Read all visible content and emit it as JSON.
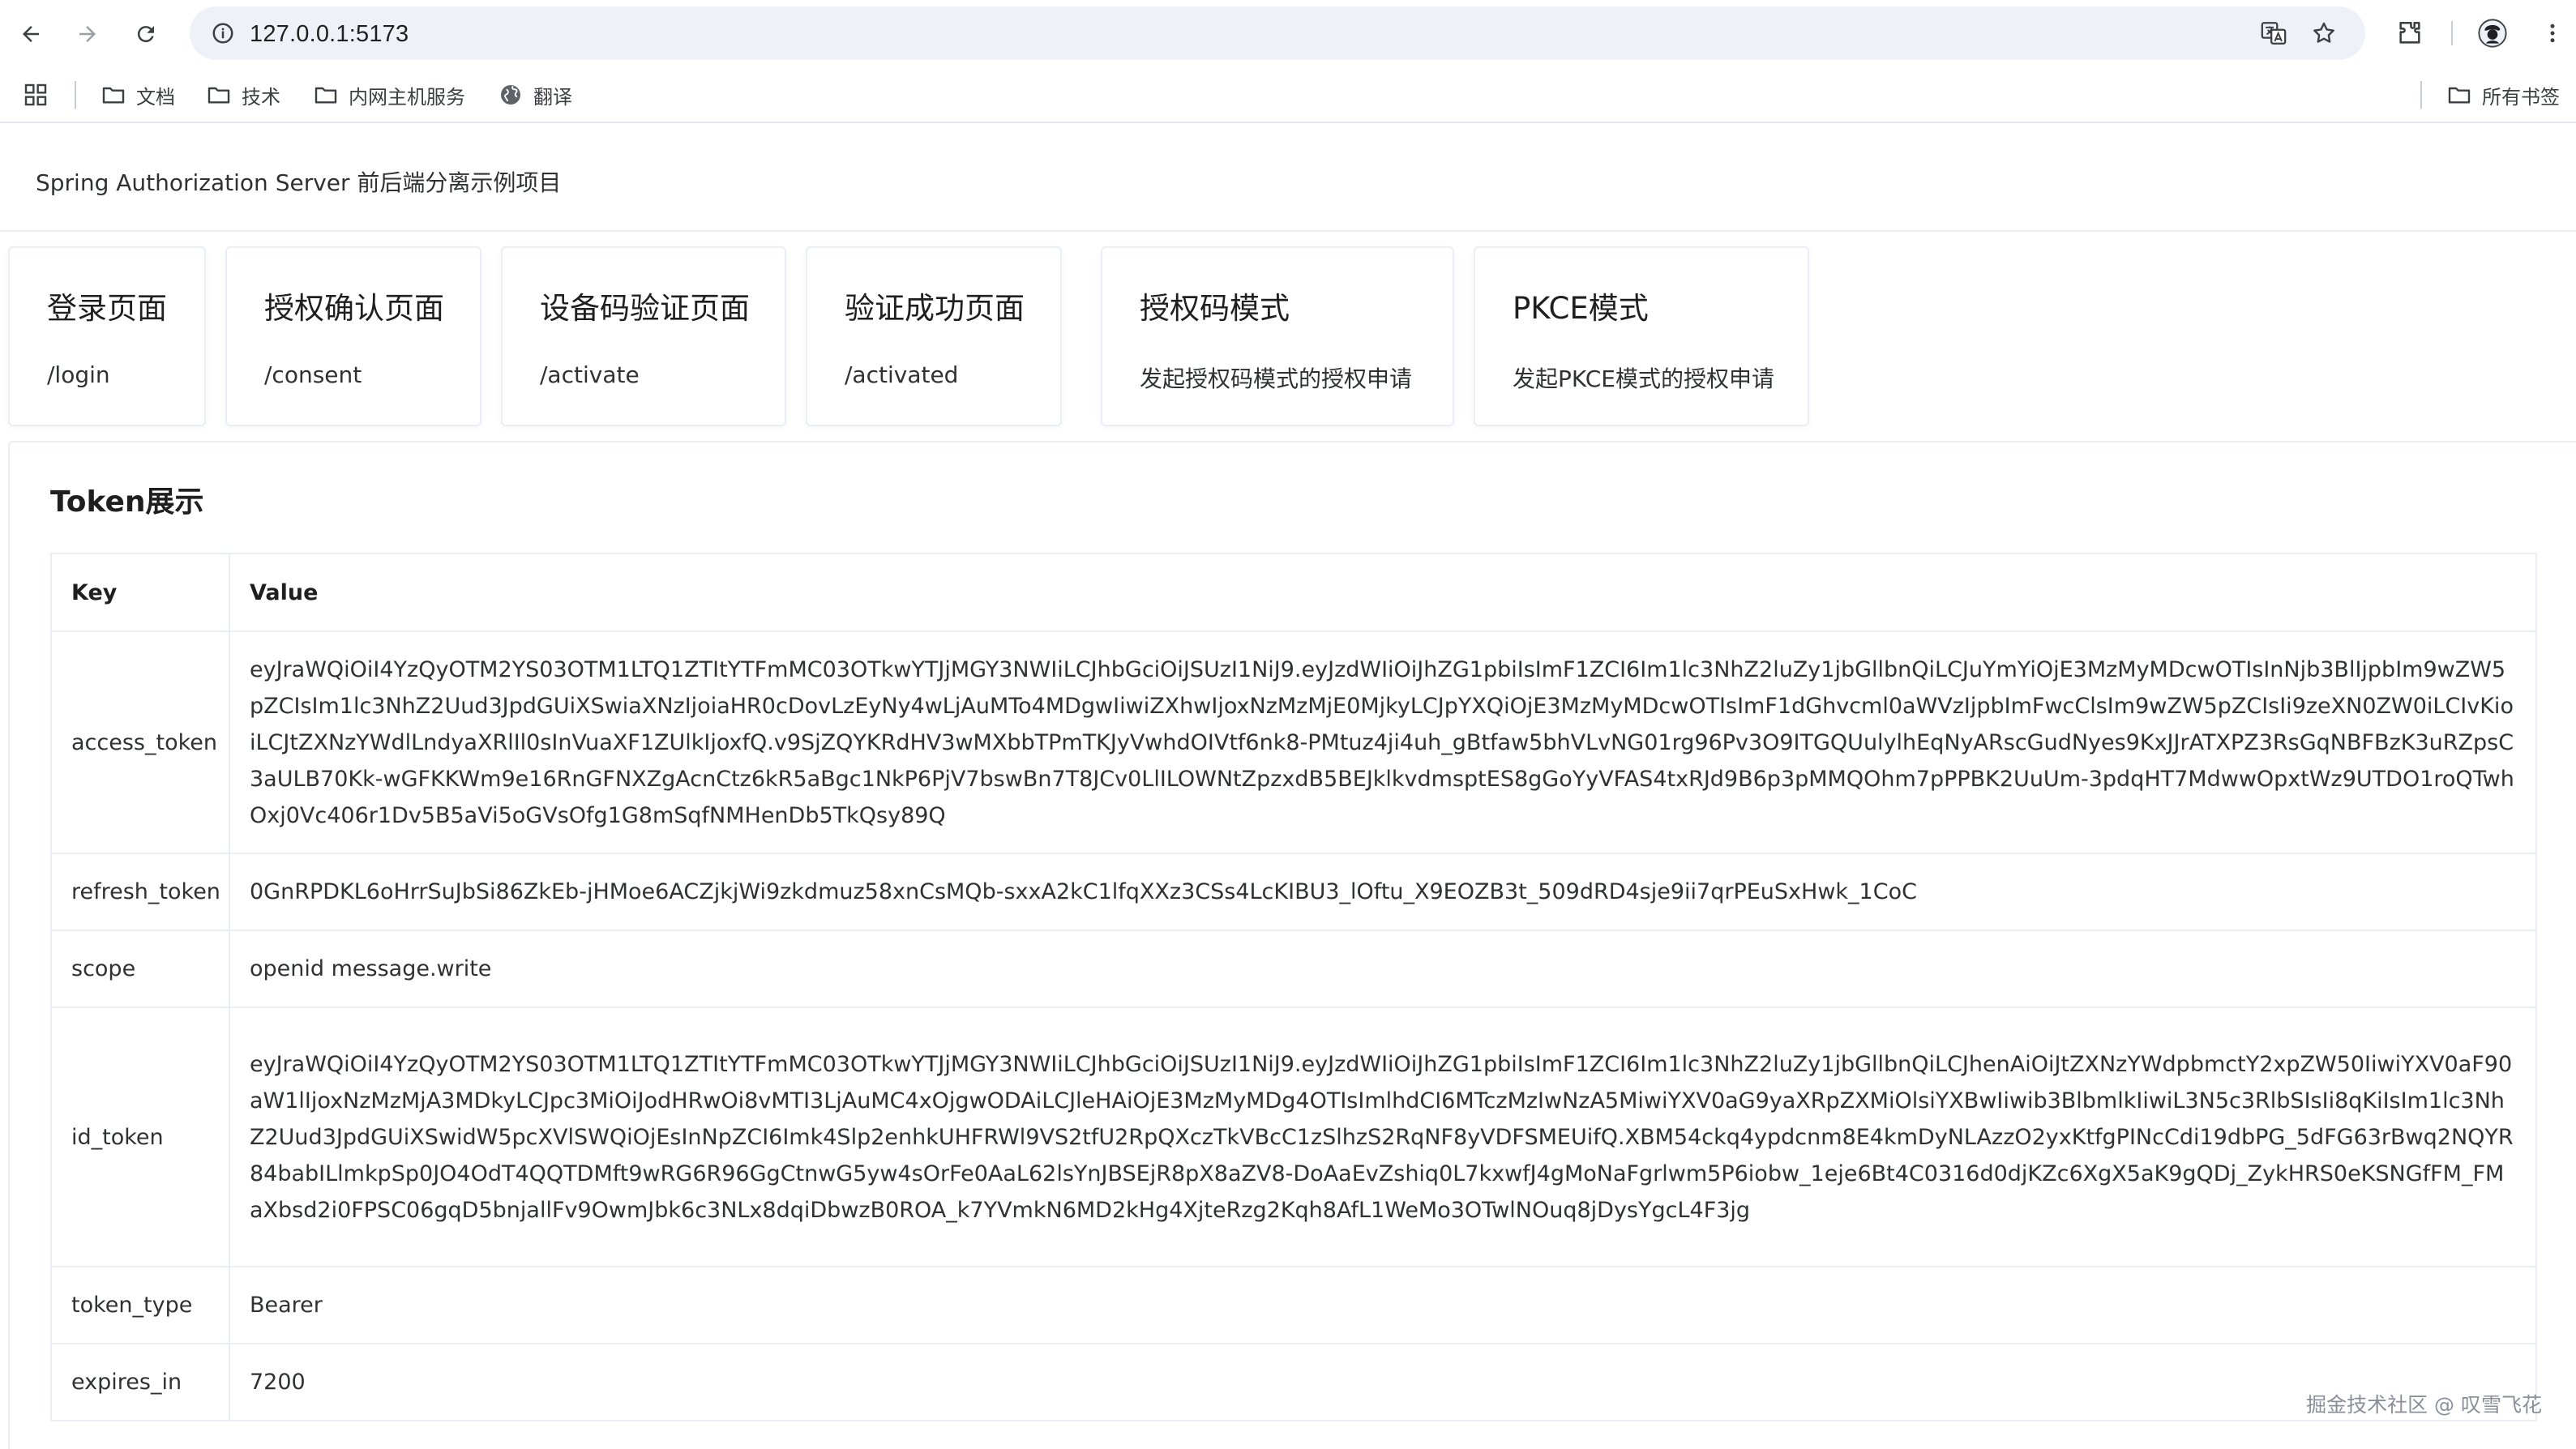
{
  "browser": {
    "url": "127.0.0.1:5173",
    "icons": [
      "back-icon",
      "forward-icon",
      "reload-icon",
      "site-info-icon",
      "translate-icon",
      "star-icon",
      "extensions-icon",
      "profile-icon",
      "menu-icon"
    ]
  },
  "bookmarks": {
    "items": [
      {
        "label": "文档",
        "icon": "folder-icon"
      },
      {
        "label": "技术",
        "icon": "folder-icon"
      },
      {
        "label": "内网主机服务",
        "icon": "folder-icon"
      },
      {
        "label": "翻译",
        "icon": "globe-icon"
      }
    ],
    "all_bookmarks": "所有书签"
  },
  "app": {
    "title": "Spring Authorization Server 前后端分离示例项目"
  },
  "cards": [
    {
      "title": "登录页面",
      "subtitle": "/login"
    },
    {
      "title": "授权确认页面",
      "subtitle": "/consent"
    },
    {
      "title": "设备码验证页面",
      "subtitle": "/activate"
    },
    {
      "title": "验证成功页面",
      "subtitle": "/activated"
    },
    {
      "title": "授权码模式",
      "subtitle": "发起授权码模式的授权申请"
    },
    {
      "title": "PKCE模式",
      "subtitle": "发起PKCE模式的授权申请"
    }
  ],
  "token_panel": {
    "title": "Token展示",
    "headers": {
      "key": "Key",
      "value": "Value"
    },
    "rows": [
      {
        "key": "access_token",
        "value": "eyJraWQiOiI4YzQyOTM2YS03OTM1LTQ1ZTItYTFmMC03OTkwYTJjMGY3NWIiLCJhbGciOiJSUzI1NiJ9.eyJzdWIiOiJhZG1pbiIsImF1ZCI6Im1lc3NhZ2luZy1jbGllbnQiLCJuYmYiOjE3MzMyMDcwOTIsInNjb3BlIjpbIm9wZW5pZCIsIm1lc3NhZ2Uud3JpdGUiXSwiaXNzIjoiaHR0cDovLzEyNy4wLjAuMTo4MDgwIiwiZXhwIjoxNzMzMjE0MjkyLCJpYXQiOjE3MzMyMDcwOTIsImF1dGhvcml0aWVzIjpbImFwcClsIm9wZW5pZCIsIi9zeXN0ZW0iLCIvKioiLCJtZXNzYWdlLndyaXRlIl0sInVuaXF1ZUlkIjoxfQ.v9SjZQYKRdHV3wMXbbTPmTKJyVwhdOIVtf6nk8-PMtuz4ji4uh_gBtfaw5bhVLvNG01rg96Pv3O9ITGQUulylhEqNyARscGudNyes9KxJJrATXPZ3RsGqNBFBzK3uRZpsC3aULB70Kk-wGFKKWm9e16RnGFNXZgAcnCtz6kR5aBgc1NkP6PjV7bswBn7T8JCv0LlILOWNtZpzxdB5BEJklkvdmsptES8gGoYyVFAS4txRJd9B6p3pMMQOhm7pPPBK2UuUm-3pdqHT7MdwwOpxtWz9UTDO1roQTwhOxj0Vc406r1Dv5B5aVi5oGVsOfg1G8mSqfNMHenDb5TkQsy89Q"
      },
      {
        "key": "refresh_token",
        "value": "0GnRPDKL6oHrrSuJbSi86ZkEb-jHMoe6ACZjkjWi9zkdmuz58xnCsMQb-sxxA2kC1lfqXXz3CSs4LcKIBU3_lOftu_X9EOZB3t_509dRD4sje9ii7qrPEuSxHwk_1CoC"
      },
      {
        "key": "scope",
        "value": "openid message.write"
      },
      {
        "key": "id_token",
        "value": "eyJraWQiOiI4YzQyOTM2YS03OTM1LTQ1ZTItYTFmMC03OTkwYTJjMGY3NWIiLCJhbGciOiJSUzI1NiJ9.eyJzdWIiOiJhZG1pbiIsImF1ZCI6Im1lc3NhZ2luZy1jbGllbnQiLCJhenAiOiJtZXNzYWdpbmctY2xpZW50IiwiYXV0aF90aW1lIjoxNzMzMjA3MDkyLCJpc3MiOiJodHRwOi8vMTI3LjAuMC4xOjgwODAiLCJleHAiOjE3MzMyMDg4OTIsImlhdCI6MTczMzIwNzA5MiwiYXV0aG9yaXRpZXMiOlsiYXBwIiwib3BlbmlkIiwiL3N5c3RlbSIsIi8qKiIsIm1lc3NhZ2Uud3JpdGUiXSwidW5pcXVlSWQiOjEsInNpZCI6Imk4Slp2enhkUHFRWl9VS2tfU2RpQXczTkVBcC1zSlhzS2RqNF8yVDFSMEUifQ.XBM54ckq4ypdcnm8E4kmDyNLAzzO2yxKtfgPINcCdi19dbPG_5dFG63rBwq2NQYR84babILlmkpSp0JO4OdT4QQTDMft9wRG6R96GgCtnwG5yw4sOrFe0AaL62lsYnJBSEjR8pX8aZV8-DoAaEvZshiq0L7kxwfJ4gMoNaFgrlwm5P6iobw_1eje6Bt4C0316d0djKZc6XgX5aK9gQDj_ZykHRS0eKSNGfFM_FMaXbsd2i0FPSC06gqD5bnjallFv9OwmJbk6c3NLx8dqiDbwzB0ROA_k7YVmkN6MD2kHg4XjteRzg2Kqh8AfL1WeMo3OTwlNOuq8jDysYgcL4F3jg"
      },
      {
        "key": "token_type",
        "value": "Bearer"
      },
      {
        "key": "expires_in",
        "value": "7200"
      }
    ]
  },
  "watermark": "掘金技术社区 @ 叹雪飞花"
}
